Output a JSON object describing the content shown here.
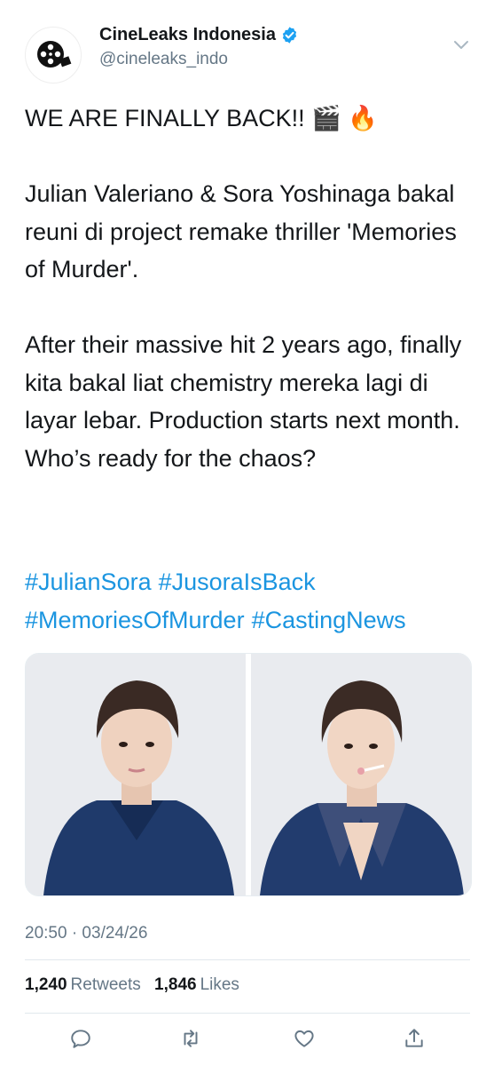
{
  "author": {
    "name": "CineLeaks Indonesia",
    "handle": "@cineleaks_indo",
    "verified": true,
    "avatar_icon": "film-reel-icon"
  },
  "tweet": {
    "text": "WE ARE FINALLY BACK!! 🎬 🔥\n\nJulian Valeriano & Sora Yoshinaga bakal reuni di project remake thriller 'Memories of Murder'.\n\nAfter their massive hit 2 years ago, finally kita bakal liat chemistry mereka lagi di layar lebar. Production starts next month. Who’s ready for the chaos?",
    "hashtags": [
      "#JulianSora",
      "#JusoraIsBack",
      "#MemoriesOfMurder",
      "#CastingNews"
    ],
    "timestamp": "20:50 · 03/24/26"
  },
  "stats": {
    "retweets_count": "1,240",
    "retweets_label": "Retweets",
    "likes_count": "1,846",
    "likes_label": "Likes"
  },
  "colors": {
    "link": "#1b95e0",
    "secondary_text": "#657786",
    "verified": "#1da1f2",
    "divider": "#e1e8ed"
  },
  "actions": [
    "reply-icon",
    "retweet-icon",
    "like-icon",
    "share-icon"
  ]
}
